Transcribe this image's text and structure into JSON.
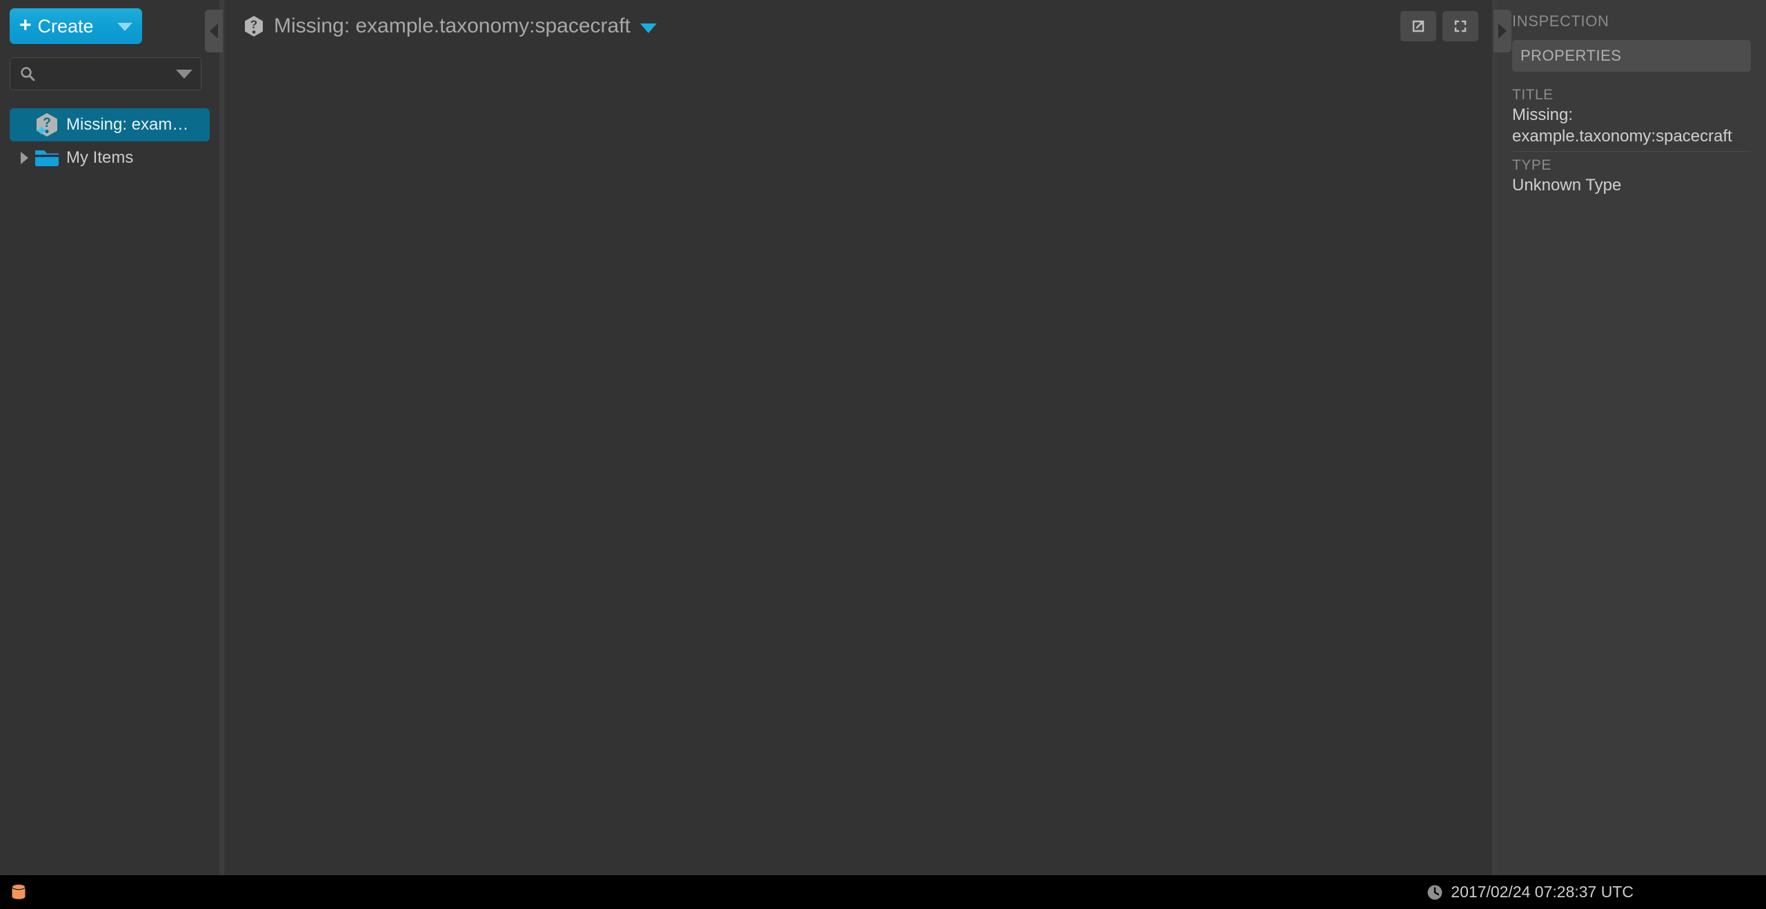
{
  "app": {
    "background_color": "#333333",
    "accent_color": "#18aee0",
    "selected_color": "#0a6b8c"
  },
  "sidebar": {
    "create_button": {
      "label": "Create",
      "plus_glyph": "+",
      "caret_icon": "chevron-down-icon"
    },
    "search": {
      "value": "",
      "placeholder": "",
      "icon": "search-icon",
      "caret_icon": "chevron-down-icon"
    },
    "tree": [
      {
        "label": "Missing: exam…",
        "icon": "unknown-object-hexagon-icon",
        "selected": true,
        "has_twisty": false,
        "expanded": false
      },
      {
        "label": "My Items",
        "icon": "folder-icon",
        "selected": false,
        "has_twisty": true,
        "expanded": false
      }
    ]
  },
  "splitters": {
    "left_handle_icon": "chevron-left-icon",
    "right_handle_icon": "chevron-right-icon"
  },
  "main": {
    "object_header": {
      "type_icon": "unknown-object-hexagon-icon",
      "title": "Missing: example.taxonomy:spacecraft",
      "title_caret_icon": "chevron-down-icon",
      "actions": [
        {
          "name": "open-in-new-window-button",
          "icon": "external-link-icon"
        },
        {
          "name": "fullscreen-button",
          "icon": "expand-icon"
        }
      ]
    }
  },
  "inspector": {
    "title": "INSPECTION",
    "tabs": [
      {
        "label": "PROPERTIES",
        "active": true
      }
    ],
    "properties": [
      {
        "key": "TITLE",
        "value": "Missing: example.taxonomy:spacecraft"
      },
      {
        "key": "TYPE",
        "value": "Unknown Type"
      }
    ]
  },
  "statusbar": {
    "indicator_icon": "database-icon",
    "clock_icon": "clock-icon",
    "timestamp": "2017/02/24 07:28:37 UTC"
  }
}
